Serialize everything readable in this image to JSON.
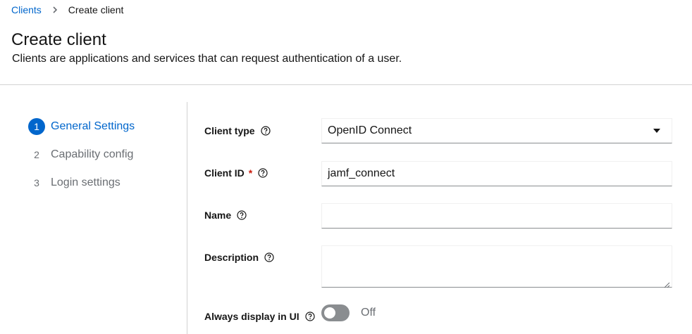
{
  "breadcrumb": {
    "parent": "Clients",
    "current": "Create client"
  },
  "page": {
    "title": "Create client",
    "description": "Clients are applications and services that can request authentication of a user."
  },
  "wizard": {
    "steps": [
      {
        "number": "1",
        "label": "General Settings",
        "active": true
      },
      {
        "number": "2",
        "label": "Capability config",
        "active": false
      },
      {
        "number": "3",
        "label": "Login settings",
        "active": false
      }
    ]
  },
  "form": {
    "client_type": {
      "label": "Client type",
      "value": "OpenID Connect"
    },
    "client_id": {
      "label": "Client ID",
      "required_mark": "*",
      "value": "jamf_connect"
    },
    "name": {
      "label": "Name",
      "value": ""
    },
    "description": {
      "label": "Description",
      "value": ""
    },
    "always_display": {
      "label": "Always display in UI",
      "state_text": "Off",
      "enabled": false
    }
  },
  "colors": {
    "link": "#0066cc",
    "required": "#c9190b",
    "switch_off": "#8a8d90"
  },
  "icons": [
    "chevron-right-icon",
    "help-icon",
    "caret-down-icon"
  ]
}
